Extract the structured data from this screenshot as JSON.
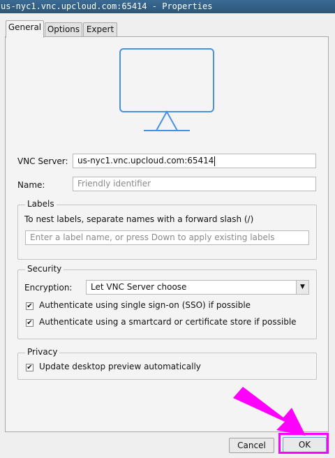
{
  "window": {
    "title": "us-nyc1.vnc.upcloud.com:65414 - Properties"
  },
  "tabs": [
    {
      "label": "General"
    },
    {
      "label": "Options"
    },
    {
      "label": "Expert"
    }
  ],
  "icons": {
    "preview": "monitor-icon",
    "checkbox": "check-icon",
    "dropdown": "triangle-down-icon"
  },
  "form": {
    "vnc_server_label": "VNC Server:",
    "vnc_server_value": "us-nyc1.vnc.upcloud.com:65414",
    "name_label": "Name:",
    "name_placeholder": "Friendly identifier"
  },
  "labels": {
    "title": "Labels",
    "hint": "To nest labels, separate names with a forward slash (/)",
    "input_placeholder": "Enter a label name, or press Down to apply existing labels"
  },
  "security": {
    "title": "Security",
    "encryption_label": "Encryption:",
    "encryption_value": "Let VNC Server choose",
    "sso_label": "Authenticate using single sign-on (SSO) if possible",
    "sso_checked": true,
    "smartcard_label": "Authenticate using a smartcard or certificate store if possible",
    "smartcard_checked": true
  },
  "privacy": {
    "title": "Privacy",
    "preview_label": "Update desktop preview automatically",
    "preview_checked": true
  },
  "buttons": {
    "cancel": "Cancel",
    "ok": "OK"
  },
  "colors": {
    "annotation": "#ff00ff",
    "monitor": "#4a90e2",
    "titlebar": "#2f5a80"
  }
}
